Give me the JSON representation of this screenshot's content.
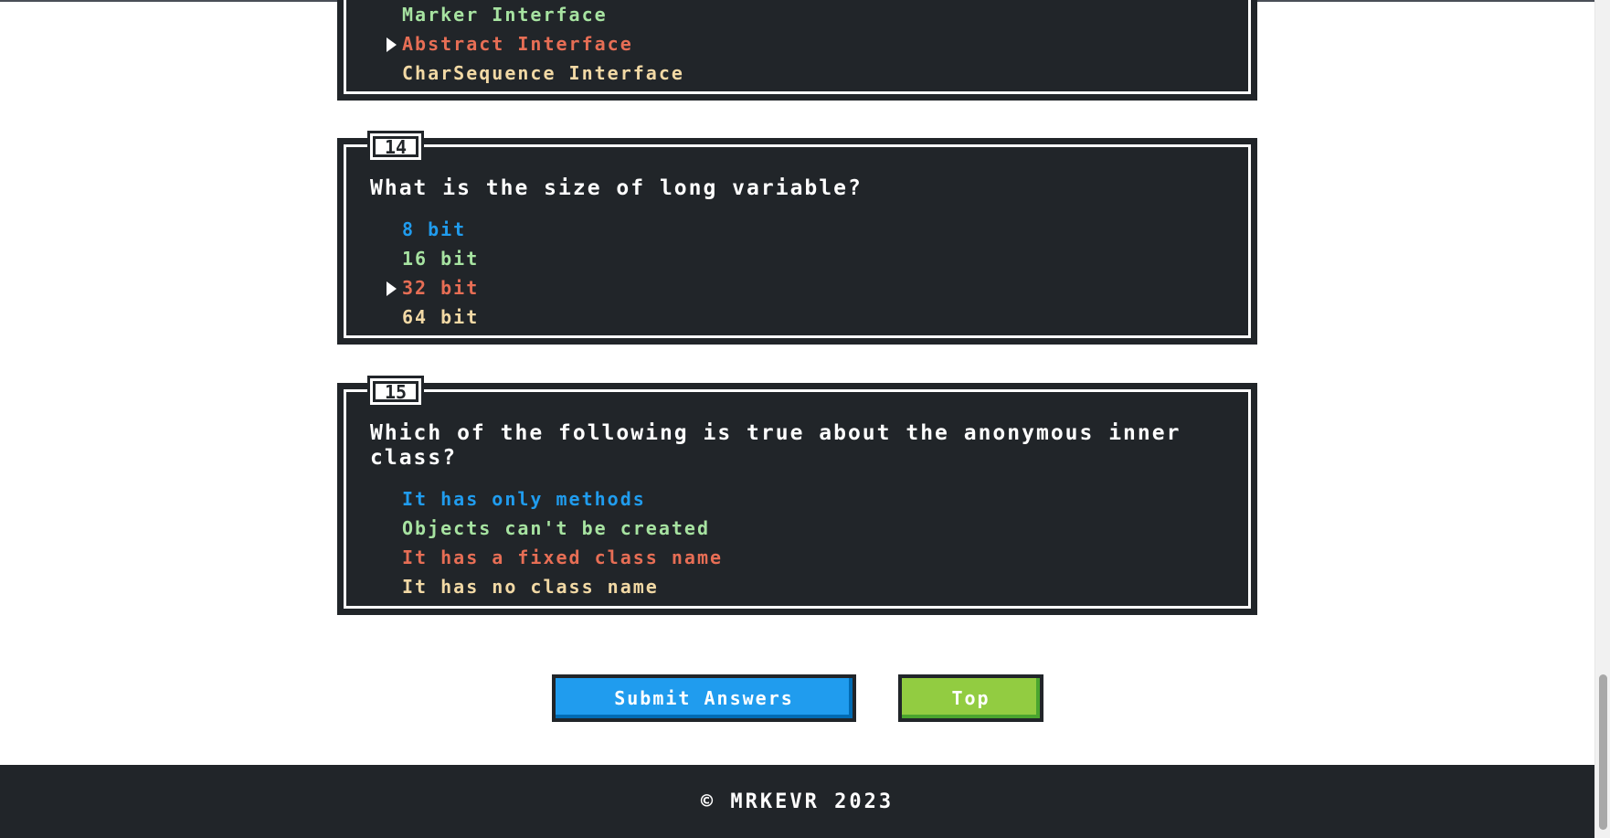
{
  "questions": [
    {
      "number": "",
      "text": "",
      "options": [
        {
          "label": "Marker Interface",
          "color": "#a7e3a1",
          "selected": false
        },
        {
          "label": "Abstract Interface",
          "color": "#e76e55",
          "selected": true
        },
        {
          "label": "CharSequence Interface",
          "color": "#f2d9a5",
          "selected": false
        }
      ]
    },
    {
      "number": "14",
      "text": "What is the size of long variable?",
      "options": [
        {
          "label": "8 bit",
          "color": "#209cee",
          "selected": false
        },
        {
          "label": "16 bit",
          "color": "#a7e3a1",
          "selected": false
        },
        {
          "label": "32 bit",
          "color": "#e76e55",
          "selected": true
        },
        {
          "label": "64 bit",
          "color": "#f2d9a5",
          "selected": false
        }
      ]
    },
    {
      "number": "15",
      "text": "Which of the following is true about the anonymous inner class?",
      "options": [
        {
          "label": "It has only methods",
          "color": "#209cee",
          "selected": false
        },
        {
          "label": "Objects can't be created",
          "color": "#a7e3a1",
          "selected": false
        },
        {
          "label": "It has a fixed class name",
          "color": "#e76e55",
          "selected": false
        },
        {
          "label": "It has no class name",
          "color": "#f2d9a5",
          "selected": false
        }
      ]
    }
  ],
  "buttons": {
    "submit_label": "Submit Answers",
    "top_label": "Top"
  },
  "footer": {
    "copyright": "© MRKEVR 2023"
  },
  "colors": {
    "dark": "#212529",
    "primary": "#209cee",
    "success": "#92cc41",
    "error": "#e76e55"
  }
}
